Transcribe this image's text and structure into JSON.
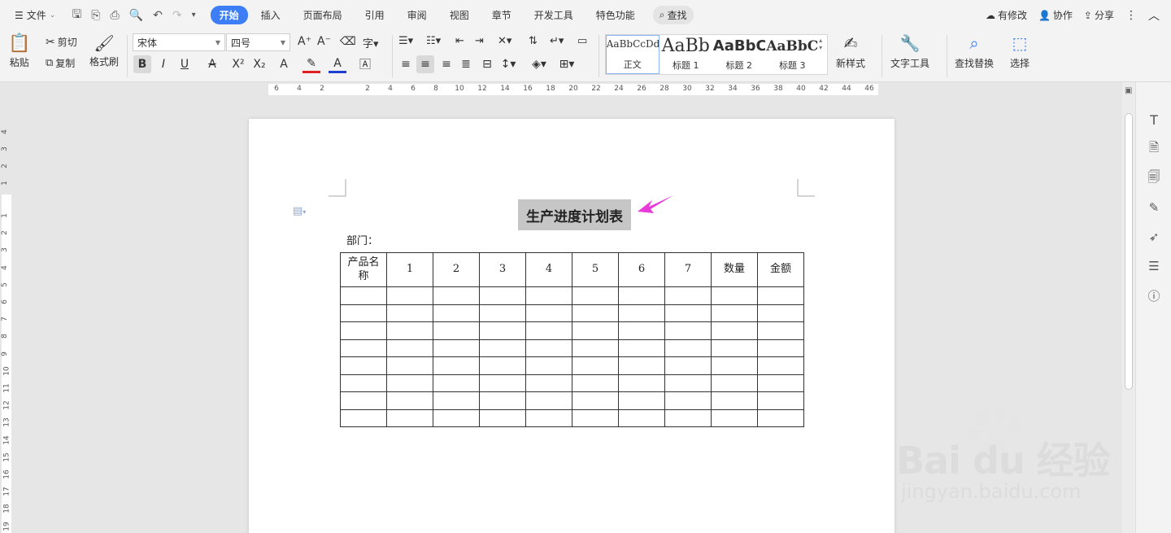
{
  "menubar": {
    "file_label": "文件",
    "tabs": [
      {
        "label": "开始",
        "active": true
      },
      {
        "label": "插入"
      },
      {
        "label": "页面布局"
      },
      {
        "label": "引用"
      },
      {
        "label": "审阅"
      },
      {
        "label": "视图"
      },
      {
        "label": "章节"
      },
      {
        "label": "开发工具"
      },
      {
        "label": "特色功能"
      }
    ],
    "search_label": "查找",
    "right": {
      "changes": "有修改",
      "collab": "协作",
      "share": "分享"
    }
  },
  "ribbon": {
    "paste": "粘贴",
    "cut": "剪切",
    "copy": "复制",
    "format_painter": "格式刷",
    "font_name": "宋体",
    "font_size": "四号",
    "bold": "B",
    "italic": "I",
    "underline": "U",
    "styles": [
      {
        "preview": "AaBbCcDd",
        "name": "正文",
        "selected": true
      },
      {
        "preview": "AaBb",
        "name": "标题 1"
      },
      {
        "preview": "AaBbC",
        "name": "标题 2"
      },
      {
        "preview": "AaBbC",
        "name": "标题 3"
      }
    ],
    "new_style": "新样式",
    "text_tools": "文字工具",
    "find_replace": "查找替换",
    "select": "选择"
  },
  "ruler": {
    "h_numbers": [
      "6",
      "4",
      "2",
      "2",
      "4",
      "6",
      "8",
      "10",
      "12",
      "14",
      "16",
      "18",
      "20",
      "22",
      "24",
      "26",
      "28",
      "30",
      "32",
      "34",
      "36",
      "38",
      "40",
      "42",
      "44",
      "46"
    ],
    "v_numbers": [
      "4",
      "3",
      "2",
      "1",
      "1",
      "2",
      "3",
      "4",
      "5",
      "6",
      "7",
      "8",
      "9",
      "10",
      "11",
      "12",
      "13",
      "14",
      "15",
      "16",
      "17",
      "18",
      "19"
    ]
  },
  "document": {
    "title": "生产进度计划表",
    "dept_label": "部门：",
    "table": {
      "headers": [
        "产品名称",
        "1",
        "2",
        "3",
        "4",
        "5",
        "6",
        "7",
        "数量",
        "金额"
      ],
      "empty_rows": 8
    }
  },
  "watermark": {
    "brand": "Bai du 经验",
    "url": "jingyan.baidu.com"
  },
  "colors": {
    "accent": "#3d7df6",
    "arrow": "#e83ad8",
    "title_highlight": "#c6c6c6"
  }
}
